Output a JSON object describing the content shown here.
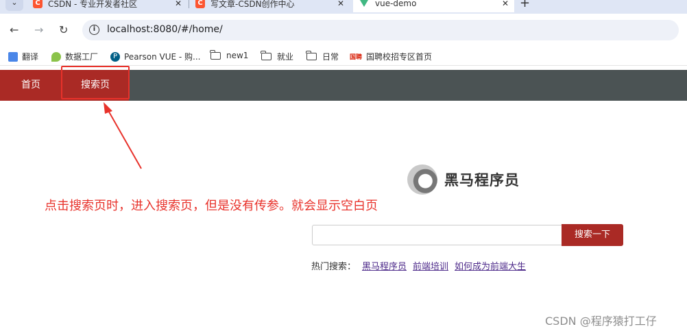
{
  "browser": {
    "tabs": [
      {
        "title": "CSDN - 专业开发者社区",
        "favicon": "C"
      },
      {
        "title": "写文章-CSDN创作中心",
        "favicon": "C"
      },
      {
        "title": "vue-demo",
        "favicon": "vue-logo-icon"
      }
    ],
    "url": "localhost:8080/#/home/",
    "bookmarks": [
      "翻译",
      "数据工厂",
      "Pearson VUE - 购...",
      "new1",
      "就业",
      "日常",
      "国聘校招专区首页"
    ]
  },
  "app": {
    "nav": {
      "home": "首页",
      "search": "搜索页"
    },
    "logo_text": "黑马程序员",
    "search": {
      "placeholder": "",
      "button": "搜索一下"
    },
    "hot": {
      "label": "热门搜索：",
      "links": [
        "黑马程序员",
        "前端培训",
        "如何成为前端大生"
      ]
    }
  },
  "annotation": {
    "note": "点击搜索页时，进入搜索页，但是没有传参。就会显示空白页"
  },
  "watermark": "CSDN @程序猿打工仔",
  "colors": {
    "nav_red": "#aa2a25",
    "nav_gray": "#4b5354",
    "annotation_red": "#e8322b"
  }
}
